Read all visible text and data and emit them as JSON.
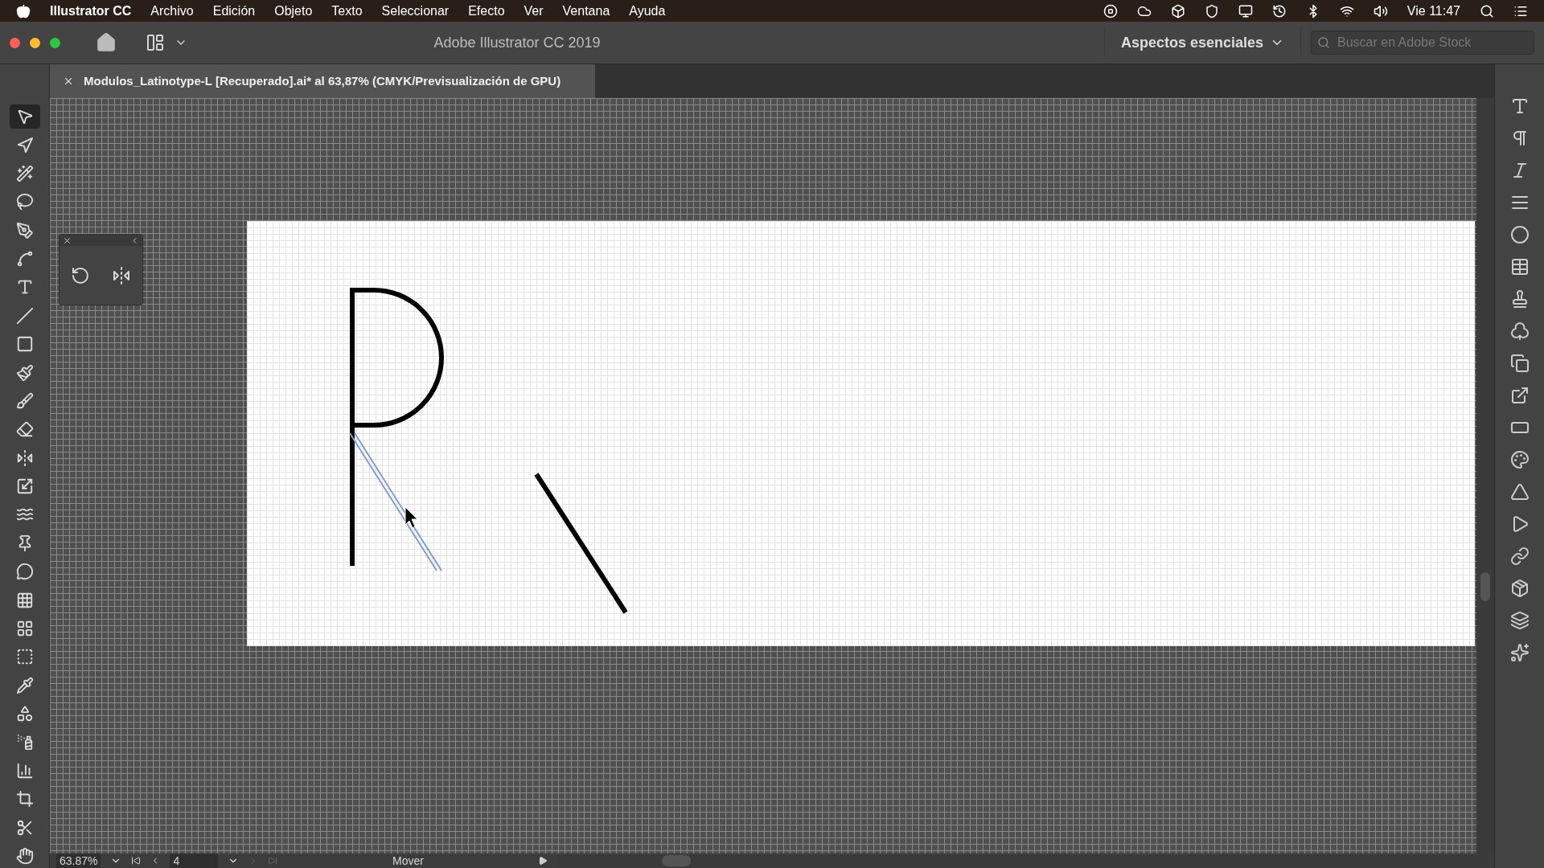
{
  "menu_bar": {
    "app": "Illustrator CC",
    "items": [
      "Archivo",
      "Edición",
      "Objeto",
      "Texto",
      "Seleccionar",
      "Efecto",
      "Ver",
      "Ventana",
      "Ayuda"
    ],
    "clock": "Vie 11:47"
  },
  "window": {
    "title": "Adobe Illustrator CC 2019",
    "workspace": "Aspectos esenciales",
    "search": {
      "placeholder": "Buscar en Adobe Stock"
    }
  },
  "document_tab": {
    "title": "Modulos_Latinotype-L [Recuperado].ai* al 63,87% (CMYK/Previsualización de GPU)"
  },
  "tools": [
    {
      "kind": "select",
      "selected": true
    },
    {
      "kind": "direct",
      "selected": false
    },
    {
      "kind": "wand",
      "selected": false
    },
    {
      "kind": "lasso",
      "selected": false
    },
    {
      "kind": "pen",
      "selected": false
    },
    {
      "kind": "curvature",
      "selected": false
    },
    {
      "kind": "type",
      "selected": false
    },
    {
      "kind": "line",
      "selected": false
    },
    {
      "kind": "rect",
      "selected": false
    },
    {
      "kind": "brush",
      "selected": false
    },
    {
      "kind": "blob",
      "selected": false
    },
    {
      "kind": "eraser",
      "selected": false
    },
    {
      "kind": "reflect",
      "selected": false
    },
    {
      "kind": "scale",
      "selected": false
    },
    {
      "kind": "warp",
      "selected": false
    },
    {
      "kind": "pin",
      "selected": false
    },
    {
      "kind": "puppet",
      "selected": false
    },
    {
      "kind": "perspective",
      "selected": false
    },
    {
      "kind": "mesh",
      "selected": false
    },
    {
      "kind": "gradient",
      "selected": false
    },
    {
      "kind": "eyedropper",
      "selected": false
    },
    {
      "kind": "blend",
      "selected": false
    },
    {
      "kind": "symbol",
      "selected": false
    },
    {
      "kind": "graph",
      "selected": false
    },
    {
      "kind": "artboard",
      "selected": false
    },
    {
      "kind": "slice",
      "selected": false
    },
    {
      "kind": "hand",
      "selected": false
    }
  ],
  "status_bar": {
    "zoom": "63.87%",
    "artboard": "4",
    "tool": "Mover"
  }
}
